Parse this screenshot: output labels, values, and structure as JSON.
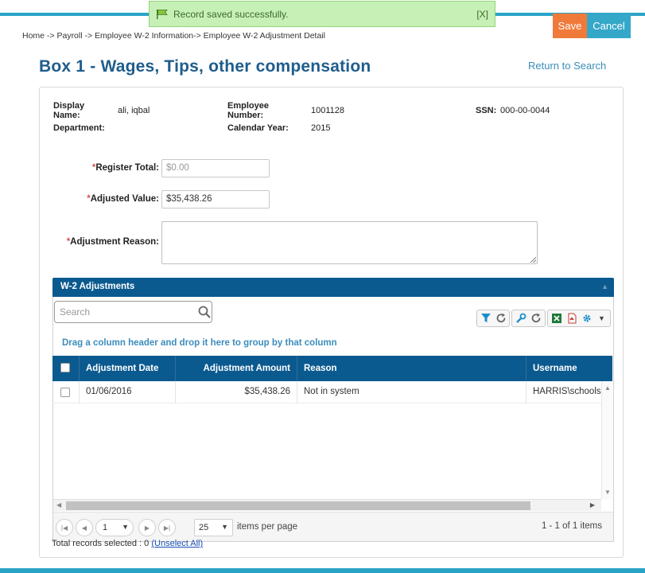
{
  "notification": {
    "message": "Record saved successfully.",
    "close_label": "[X]"
  },
  "toolbar": {
    "save_label": "Save",
    "cancel_label": "Cancel"
  },
  "breadcrumb": "Home -> Payroll -> Employee W-2 Information-> Employee W-2 Adjustment Detail",
  "page_title": "Box 1 - Wages, Tips, other compensation",
  "return_link": "Return to Search",
  "employee": {
    "display_name_label": "Display Name:",
    "display_name": "ali, iqbal",
    "department_label": "Department:",
    "department": "",
    "employee_number_label": "Employee Number:",
    "employee_number": "1001128",
    "calendar_year_label": "Calendar Year:",
    "calendar_year": "2015",
    "ssn_label": "SSN:",
    "ssn": "000-00-0044"
  },
  "form": {
    "required_mark": "*",
    "register_total_label": "Register Total:",
    "register_total_value": "$0.00",
    "adjusted_value_label": "Adjusted Value:",
    "adjusted_value": "$35,438.26",
    "adjustment_reason_label": "Adjustment Reason:",
    "adjustment_reason_value": ""
  },
  "grid": {
    "title": "W-2 Adjustments",
    "search_placeholder": "Search",
    "group_hint": "Drag a column header and drop it here to group by that column",
    "columns": [
      "Adjustment Date",
      "Adjustment Amount",
      "Reason",
      "Username"
    ],
    "rows": [
      {
        "date": "01/06/2016",
        "amount": "$35,438.26",
        "reason": "Not in system",
        "username": "HARRIS\\schools-"
      }
    ],
    "current_page": "1",
    "page_size": "25",
    "items_per_page_label": "items per page",
    "range_label": "1 - 1 of 1 items",
    "selected_text": "Total records selected : 0",
    "unselect_all": "(Unselect All)"
  },
  "colors": {
    "brand": "#0b5a8f",
    "accent": "#2aa3c7",
    "save": "#f07a3a",
    "title": "#1f5d8c"
  }
}
